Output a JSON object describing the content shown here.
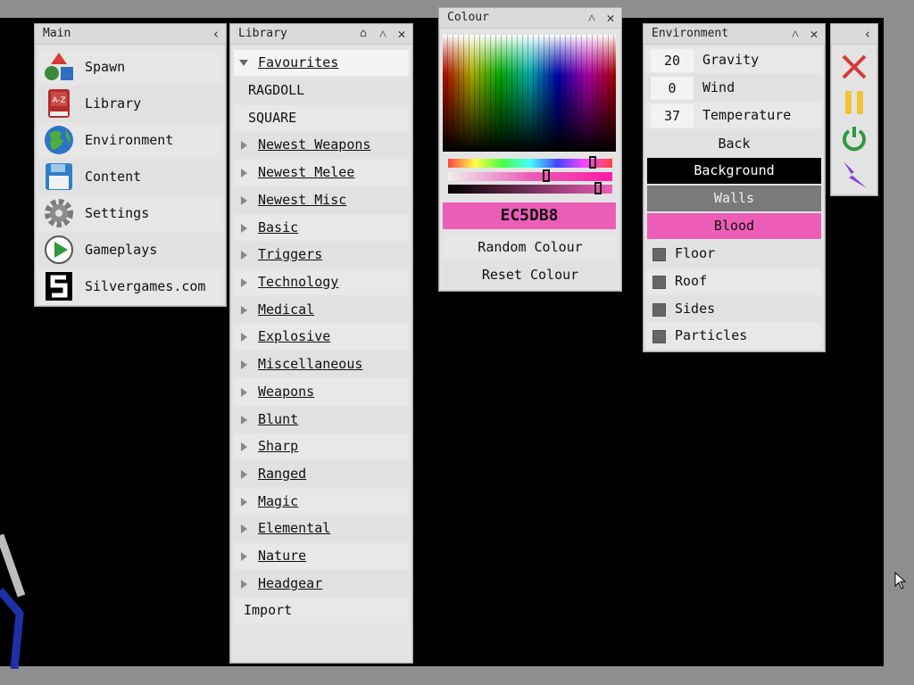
{
  "main": {
    "title": "Main",
    "items": [
      {
        "label": "Spawn",
        "icon": "spawn-shapes-icon"
      },
      {
        "label": "Library",
        "icon": "library-book-icon"
      },
      {
        "label": "Environment",
        "icon": "globe-icon"
      },
      {
        "label": "Content",
        "icon": "floppy-disk-icon"
      },
      {
        "label": "Settings",
        "icon": "gear-icon"
      },
      {
        "label": "Gameplays",
        "icon": "play-icon"
      },
      {
        "label": "Silvergames.com",
        "icon": "silvergames-logo-icon"
      }
    ]
  },
  "library": {
    "title": "Library",
    "favourites": "Favourites",
    "items": [
      "RAGDOLL",
      "SQUARE"
    ],
    "categories": [
      "Newest Weapons",
      "Newest Melee",
      "Newest Misc",
      "Basic",
      "Triggers",
      "Technology",
      "Medical",
      "Explosive",
      "Miscellaneous",
      "Weapons",
      "Blunt",
      "Sharp",
      "Ranged",
      "Magic",
      "Elemental",
      "Nature",
      "Headgear"
    ],
    "import": "Import"
  },
  "colour": {
    "title": "Colour",
    "hex": "EC5DB8",
    "hex_color": "#ec5db8",
    "random": "Random Colour",
    "reset": "Reset Colour"
  },
  "environment": {
    "title": "Environment",
    "values": [
      {
        "value": "20",
        "label": "Gravity"
      },
      {
        "value": "0",
        "label": "Wind"
      },
      {
        "value": "37",
        "label": "Temperature"
      }
    ],
    "back": "Back",
    "background": "Background",
    "walls": "Walls",
    "blood": "Blood",
    "checks": [
      "Floor",
      "Roof",
      "Sides",
      "Particles"
    ]
  },
  "toolbar": {
    "icons": [
      "close-red-icon",
      "pause-yellow-icon",
      "power-green-icon",
      "lightning-purple-icon"
    ]
  }
}
